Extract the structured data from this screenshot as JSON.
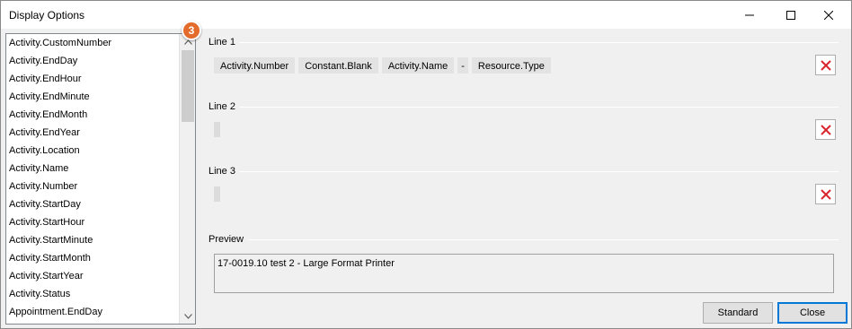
{
  "window": {
    "title": "Display Options",
    "minimize_icon": "minimize-icon",
    "maximize_icon": "maximize-icon",
    "close_icon": "close-icon"
  },
  "badge": {
    "number": "3",
    "color": "#e36b2c"
  },
  "field_list": {
    "items": [
      "Activity.CustomNumber",
      "Activity.EndDay",
      "Activity.EndHour",
      "Activity.EndMinute",
      "Activity.EndMonth",
      "Activity.EndYear",
      "Activity.Location",
      "Activity.Name",
      "Activity.Number",
      "Activity.StartDay",
      "Activity.StartHour",
      "Activity.StartMinute",
      "Activity.StartMonth",
      "Activity.StartYear",
      "Activity.Status",
      "Appointment.EndDay"
    ],
    "scroll_up_icon": "chevron-up-icon",
    "scroll_down_icon": "chevron-down-icon"
  },
  "lines": [
    {
      "label": "Line 1",
      "tokens": [
        "Activity.Number",
        "Constant.Blank",
        "Activity.Name",
        "-",
        "Resource.Type"
      ]
    },
    {
      "label": "Line 2",
      "tokens": []
    },
    {
      "label": "Line 3",
      "tokens": []
    }
  ],
  "delete_icon": "red-x-icon",
  "delete_color": "#d9262c",
  "preview": {
    "label": "Preview",
    "text": "17-0019.10 test 2 - Large Format Printer"
  },
  "buttons": {
    "standard": "Standard",
    "close": "Close"
  }
}
